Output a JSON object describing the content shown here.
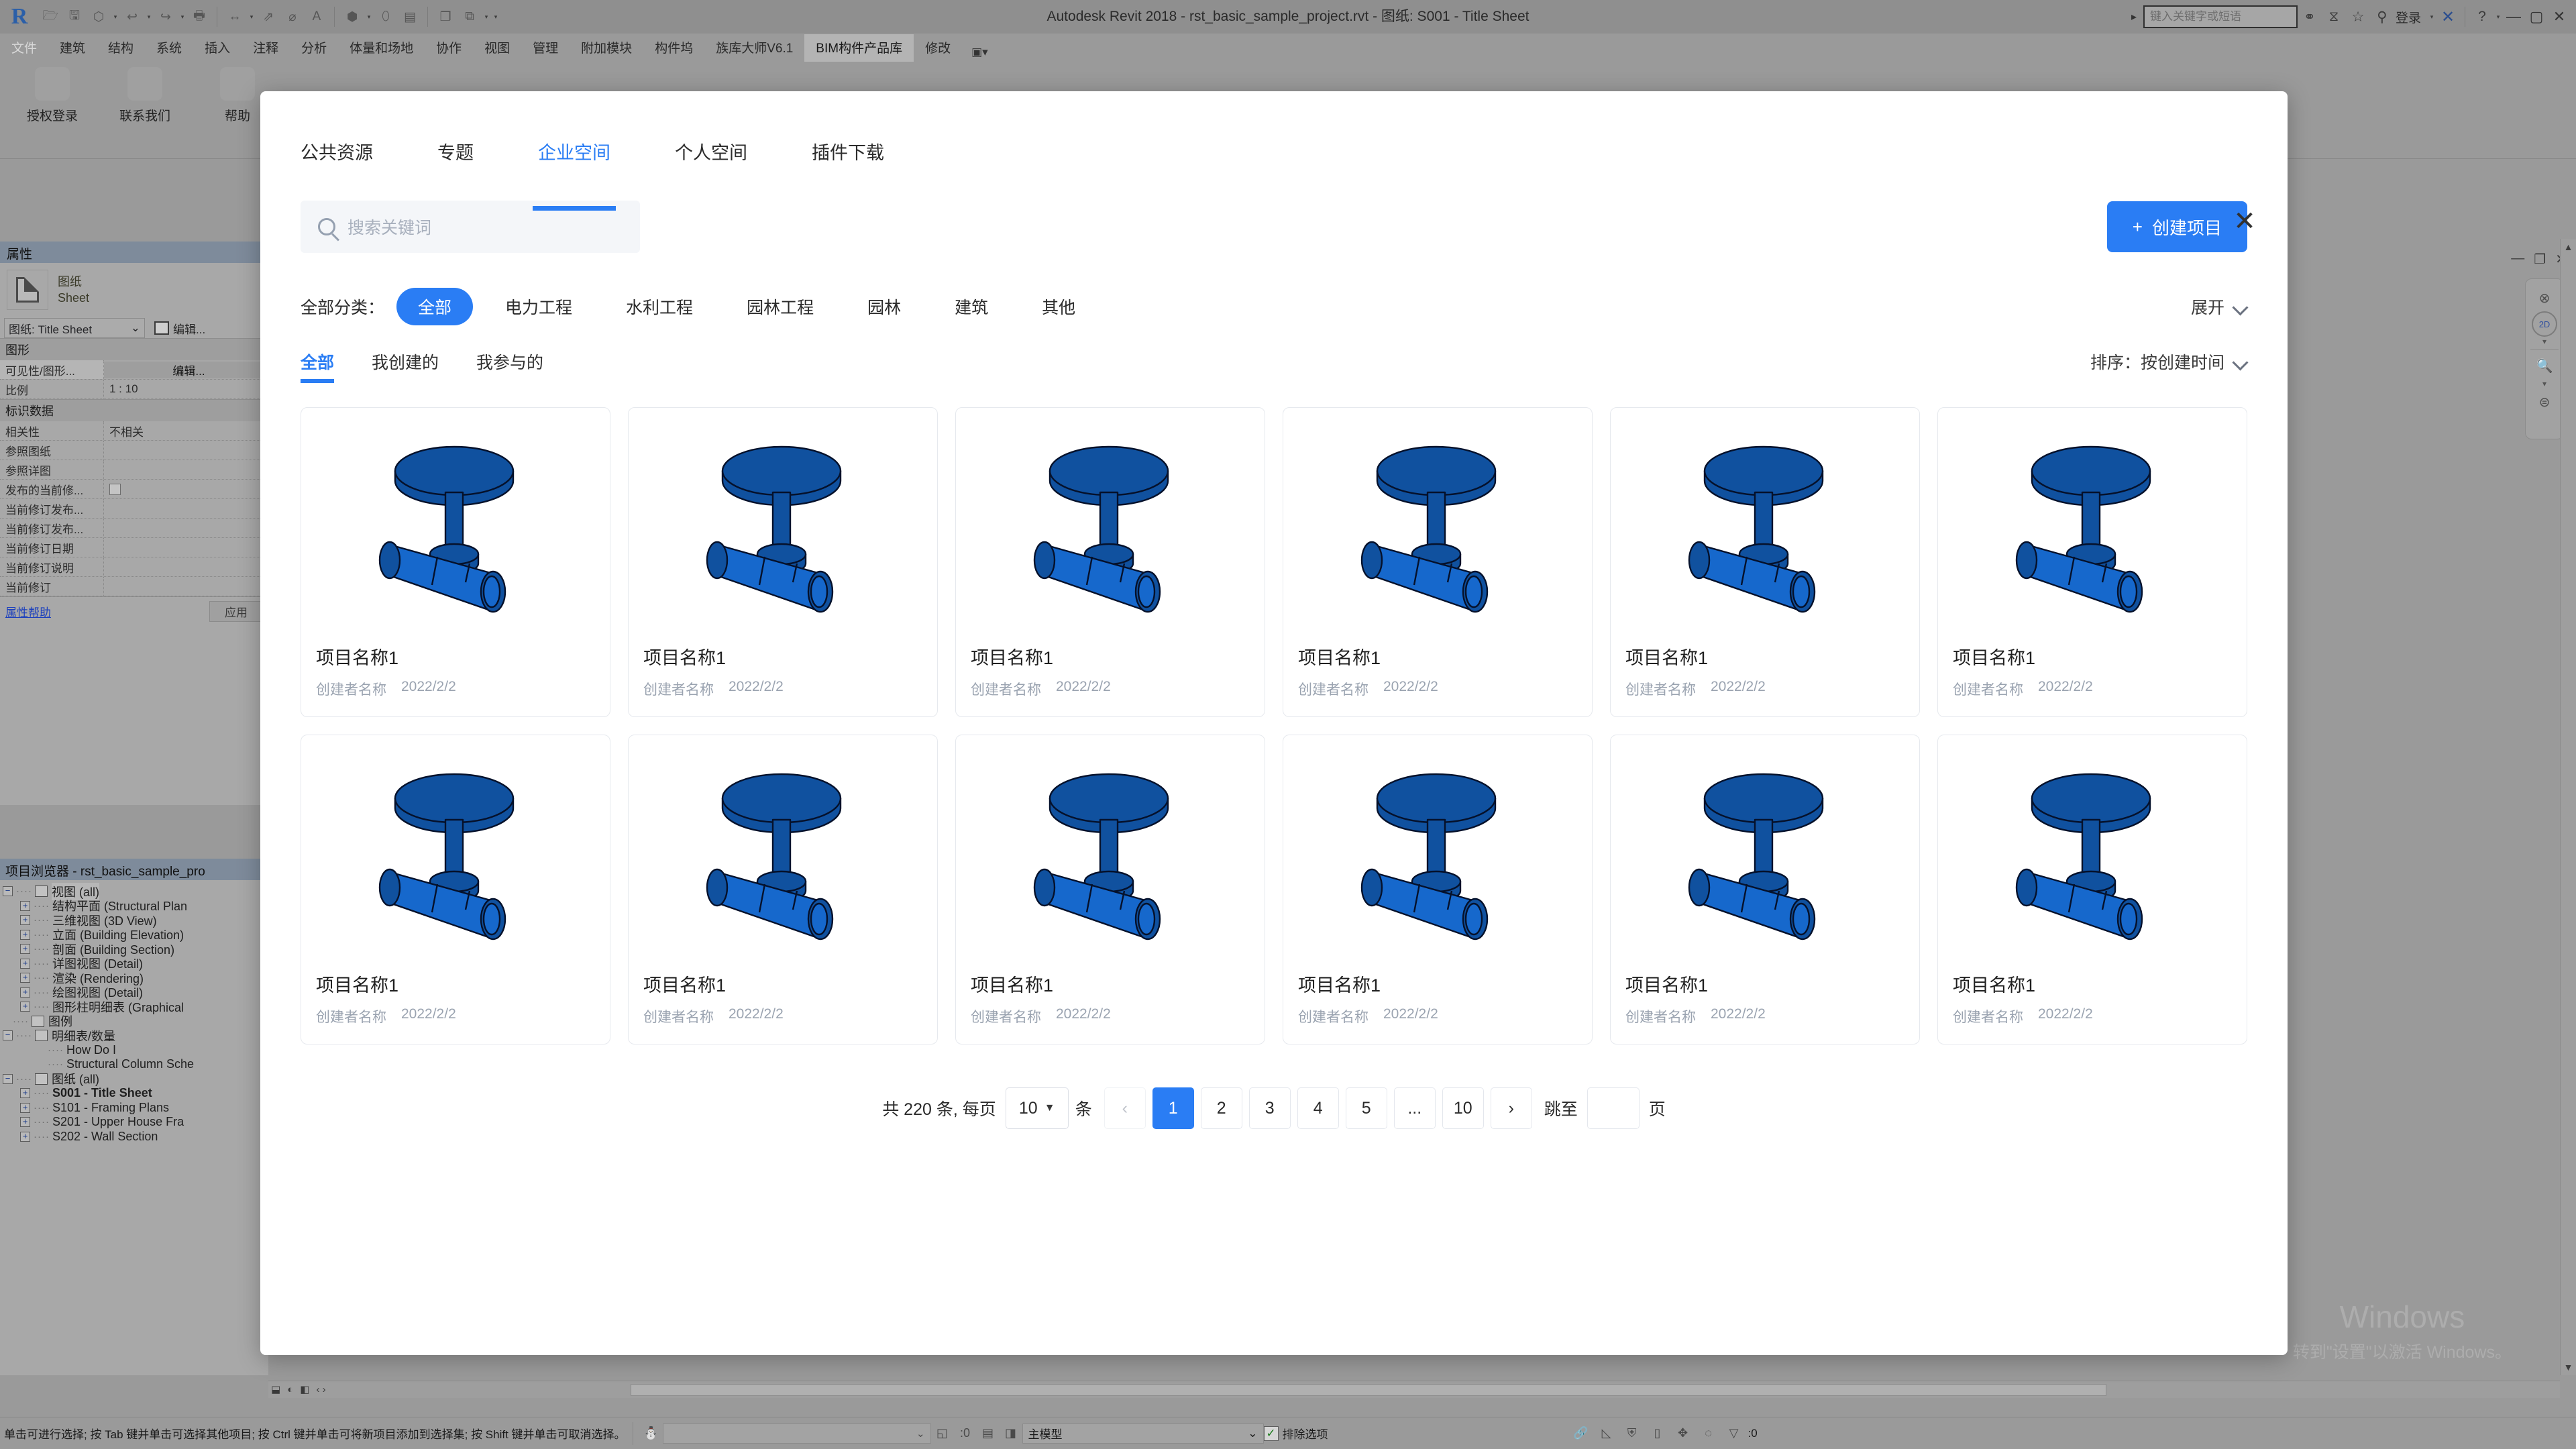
{
  "app": {
    "title": "Autodesk Revit 2018 -    rst_basic_sample_project.rvt - 图纸: S001 - Title Sheet",
    "search_placeholder": "键入关键字或短语",
    "login_label": "登录"
  },
  "ribbon": {
    "tabs": [
      {
        "label": "文件",
        "state": "dim"
      },
      {
        "label": "建筑",
        "state": "normal"
      },
      {
        "label": "结构",
        "state": "normal"
      },
      {
        "label": "系统",
        "state": "normal"
      },
      {
        "label": "插入",
        "state": "normal"
      },
      {
        "label": "注释",
        "state": "normal"
      },
      {
        "label": "分析",
        "state": "normal"
      },
      {
        "label": "体量和场地",
        "state": "normal"
      },
      {
        "label": "协作",
        "state": "normal"
      },
      {
        "label": "视图",
        "state": "normal"
      },
      {
        "label": "管理",
        "state": "normal"
      },
      {
        "label": "附加模块",
        "state": "normal"
      },
      {
        "label": "构件坞",
        "state": "normal"
      },
      {
        "label": "族库大师V6.1",
        "state": "normal"
      },
      {
        "label": "BIM构件产品库",
        "state": "active"
      },
      {
        "label": "修改",
        "state": "normal"
      }
    ],
    "tab_dropdown": "▣▾",
    "buttons": [
      {
        "label": "授权登录"
      },
      {
        "label": "联系我们"
      },
      {
        "label": "帮助"
      }
    ]
  },
  "properties": {
    "panel_title": "属性",
    "type_line1": "图纸",
    "type_line2": "Sheet",
    "selector_value": "图纸: Title Sheet",
    "edit_label": "编辑...",
    "group_graphics": "图形",
    "group_identity": "标识数据",
    "rows": [
      {
        "key": "可见性/图形...",
        "value": "编辑...",
        "kind": "button"
      },
      {
        "key": "比例",
        "value": "1 : 10",
        "kind": "text"
      },
      {
        "key": "相关性",
        "value": "不相关",
        "kind": "text"
      },
      {
        "key": "参照图纸",
        "value": "",
        "kind": "text"
      },
      {
        "key": "参照详图",
        "value": "",
        "kind": "text"
      },
      {
        "key": "发布的当前修...",
        "value": "",
        "kind": "check"
      },
      {
        "key": "当前修订发布...",
        "value": "",
        "kind": "text"
      },
      {
        "key": "当前修订发布...",
        "value": "",
        "kind": "text"
      },
      {
        "key": "当前修订日期",
        "value": "",
        "kind": "text"
      },
      {
        "key": "当前修订说明",
        "value": "",
        "kind": "text"
      },
      {
        "key": "当前修订",
        "value": "",
        "kind": "text"
      }
    ],
    "help_link": "属性帮助",
    "apply_label": "应用"
  },
  "browser": {
    "title": "项目浏览器 - rst_basic_sample_pro",
    "nodes": [
      {
        "label": "视图 (all)",
        "depth": 0,
        "expander": "−",
        "icon": true,
        "selected": true,
        "bold": false
      },
      {
        "label": "结构平面 (Structural Plan",
        "depth": 1,
        "expander": "+",
        "icon": false,
        "selected": false,
        "bold": false
      },
      {
        "label": "三维视图 (3D View)",
        "depth": 1,
        "expander": "+",
        "icon": false,
        "selected": false,
        "bold": false
      },
      {
        "label": "立面 (Building Elevation)",
        "depth": 1,
        "expander": "+",
        "icon": false,
        "selected": false,
        "bold": false
      },
      {
        "label": "剖面 (Building Section)",
        "depth": 1,
        "expander": "+",
        "icon": false,
        "selected": false,
        "bold": false
      },
      {
        "label": "详图视图 (Detail)",
        "depth": 1,
        "expander": "+",
        "icon": false,
        "selected": false,
        "bold": false
      },
      {
        "label": "渲染 (Rendering)",
        "depth": 1,
        "expander": "+",
        "icon": false,
        "selected": false,
        "bold": false
      },
      {
        "label": "绘图视图 (Detail)",
        "depth": 1,
        "expander": "+",
        "icon": false,
        "selected": false,
        "bold": false
      },
      {
        "label": "图形柱明细表 (Graphical",
        "depth": 1,
        "expander": "+",
        "icon": false,
        "selected": false,
        "bold": false
      },
      {
        "label": "图例",
        "depth": 0,
        "expander": "",
        "icon": true,
        "selected": false,
        "bold": false
      },
      {
        "label": "明细表/数量",
        "depth": 0,
        "expander": "−",
        "icon": true,
        "selected": false,
        "bold": false
      },
      {
        "label": "How Do I",
        "depth": 2,
        "expander": "",
        "icon": false,
        "selected": false,
        "bold": false
      },
      {
        "label": "Structural Column Sche",
        "depth": 2,
        "expander": "",
        "icon": false,
        "selected": false,
        "bold": false
      },
      {
        "label": "图纸 (all)",
        "depth": 0,
        "expander": "−",
        "icon": true,
        "selected": false,
        "bold": false
      },
      {
        "label": "S001 - Title Sheet",
        "depth": 1,
        "expander": "+",
        "icon": false,
        "selected": false,
        "bold": true
      },
      {
        "label": "S101 - Framing Plans",
        "depth": 1,
        "expander": "+",
        "icon": false,
        "selected": false,
        "bold": false
      },
      {
        "label": "S201 - Upper House Fra",
        "depth": 1,
        "expander": "+",
        "icon": false,
        "selected": false,
        "bold": false
      },
      {
        "label": "S202 - Wall Section",
        "depth": 1,
        "expander": "+",
        "icon": false,
        "selected": false,
        "bold": false
      }
    ]
  },
  "navbar": {
    "wheel_label": "2D"
  },
  "watermark": {
    "line1": "Windows",
    "line2": "转到\"设置\"以激活 Windows。"
  },
  "statusbar": {
    "message": "单击可进行选择; 按 Tab 键并单击可选择其他项目; 按 Ctrl 键并单击可将新项目添加到选择集; 按 Shift 键并单击可取消选择。",
    "selection_count": ":0",
    "model_value": "主模型",
    "exclude_label": "排除选项",
    "filter_count": ":0"
  },
  "modal": {
    "close_icon": "close-icon",
    "tabs": [
      {
        "label": "公共资源",
        "active": false
      },
      {
        "label": "专题",
        "active": false
      },
      {
        "label": "企业空间",
        "active": true
      },
      {
        "label": "个人空间",
        "active": false
      },
      {
        "label": "插件下载",
        "active": false
      }
    ],
    "search": {
      "placeholder": "搜索关键词",
      "value": ""
    },
    "create_button": {
      "plus": "+",
      "label": "创建项目"
    },
    "filters": {
      "label": "全部分类：",
      "chips": [
        {
          "label": "全部",
          "active": true
        },
        {
          "label": "电力工程",
          "active": false
        },
        {
          "label": "水利工程",
          "active": false
        },
        {
          "label": "园林工程",
          "active": false
        },
        {
          "label": "园林",
          "active": false
        },
        {
          "label": "建筑",
          "active": false
        },
        {
          "label": "其他",
          "active": false
        }
      ],
      "expand_label": "展开"
    },
    "subtabs": [
      {
        "label": "全部",
        "active": true
      },
      {
        "label": "我创建的",
        "active": false
      },
      {
        "label": "我参与的",
        "active": false
      }
    ],
    "sort_label": "排序：按创建时间",
    "cards": [
      {
        "name": "项目名称1",
        "author": "创建者名称",
        "date": "2022/2/2"
      },
      {
        "name": "项目名称1",
        "author": "创建者名称",
        "date": "2022/2/2"
      },
      {
        "name": "项目名称1",
        "author": "创建者名称",
        "date": "2022/2/2"
      },
      {
        "name": "项目名称1",
        "author": "创建者名称",
        "date": "2022/2/2"
      },
      {
        "name": "项目名称1",
        "author": "创建者名称",
        "date": "2022/2/2"
      },
      {
        "name": "项目名称1",
        "author": "创建者名称",
        "date": "2022/2/2"
      },
      {
        "name": "项目名称1",
        "author": "创建者名称",
        "date": "2022/2/2"
      },
      {
        "name": "项目名称1",
        "author": "创建者名称",
        "date": "2022/2/2"
      },
      {
        "name": "项目名称1",
        "author": "创建者名称",
        "date": "2022/2/2"
      },
      {
        "name": "项目名称1",
        "author": "创建者名称",
        "date": "2022/2/2"
      },
      {
        "name": "项目名称1",
        "author": "创建者名称",
        "date": "2022/2/2"
      },
      {
        "name": "项目名称1",
        "author": "创建者名称",
        "date": "2022/2/2"
      }
    ],
    "pagination": {
      "total_text": "共 220 条, 每页",
      "page_size": "10",
      "unit_text": "条",
      "prev": "‹",
      "next": "›",
      "pages": [
        "1",
        "2",
        "3",
        "4",
        "5",
        "...",
        "10"
      ],
      "current": "1",
      "jump_label": "跳至",
      "jump_value": "",
      "page_unit": "页"
    }
  },
  "colors": {
    "accent": "#2a7df4",
    "valve_light": "#1668cc",
    "valve_dark": "#10519f",
    "chrome": "#9a9a9a"
  }
}
